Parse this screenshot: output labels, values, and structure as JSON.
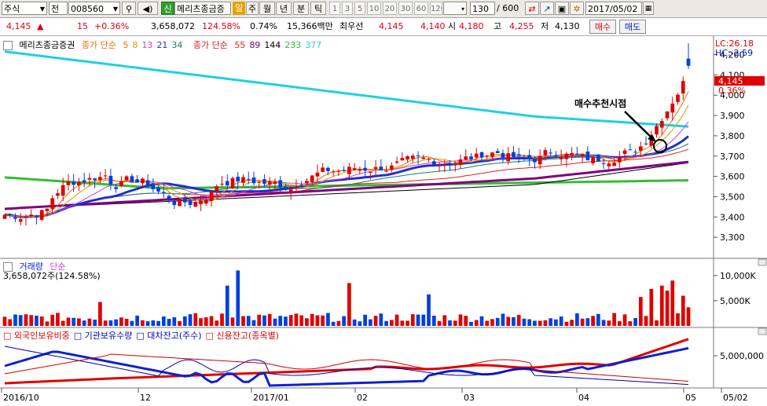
{
  "toolbar": {
    "market": "주식",
    "prev": "전",
    "code": "008560",
    "name": "메리츠종금증",
    "credit": "신",
    "periods": [
      "일",
      "주",
      "월",
      "년",
      "분",
      "틱"
    ],
    "minutes": [
      "1",
      "3",
      "5",
      "10",
      "20",
      "30",
      "60",
      "120"
    ],
    "count": "130",
    "total": "/ 600",
    "date": "2017/05/02"
  },
  "info": {
    "price": "4,145",
    "arrow": "▲",
    "change": "15",
    "rate": "+0.36%",
    "volume": "3,658,072",
    "vol_rate": "124.58%",
    "turnover": "0.74%",
    "amount": "15,366백만",
    "best_label": "최우선",
    "best_ask": "4,145",
    "best_bid": "4,140",
    "open_label": "시",
    "open": "4,180",
    "high_label": "고",
    "high": "4,255",
    "low_label": "저",
    "low": "4,130",
    "buy": "매수",
    "sell": "매도"
  },
  "price_panel": {
    "stock_label": "메리츠종금증권",
    "short_ma_label": "종가 단순",
    "short_ma": [
      {
        "p": "5",
        "c": "#f07000"
      },
      {
        "p": "8",
        "c": "#d0a000"
      },
      {
        "p": "13",
        "c": "#d040d0"
      },
      {
        "p": "21",
        "c": "#2030d0"
      },
      {
        "p": "34",
        "c": "#108070"
      }
    ],
    "long_ma_label": "종가 단순",
    "long_ma": [
      {
        "p": "55",
        "c": "#e02020"
      },
      {
        "p": "89",
        "c": "#800080"
      },
      {
        "p": "144",
        "c": "#000000"
      },
      {
        "p": "233",
        "c": "#30c030"
      },
      {
        "p": "377",
        "c": "#20d0e0"
      }
    ],
    "lc": "LC:26.18",
    "hc": "HC:-2.59",
    "current_tag": "4,145",
    "rate_tag": "0.36%",
    "annotation": "매수추천시점",
    "y_ticks": [
      "4,200",
      "4,100",
      "4,000",
      "3,900",
      "3,800",
      "3,700",
      "3,600",
      "3,500",
      "3,400",
      "3,300"
    ]
  },
  "volume_panel": {
    "title": "거래량",
    "subtitle": "단순",
    "value": "3,658,072주(124.58%)",
    "y_ticks": [
      "10,000K",
      "5,000K"
    ]
  },
  "holding_panel": {
    "items": [
      {
        "label": "외국인보유비중",
        "c": "#e00000"
      },
      {
        "label": "기관보유수량",
        "c": "#0000c0"
      },
      {
        "label": "대차잔고(주수)",
        "c": "#0000c0"
      },
      {
        "label": "신용잔고(종목별)",
        "c": "#e00000"
      }
    ],
    "y_ticks": [
      "5,000,000"
    ]
  },
  "x_axis": [
    "2016/10",
    "12",
    "2017/01",
    "02",
    "03",
    "04",
    "05",
    "05/02"
  ],
  "chart_data": {
    "type": "candlestick",
    "y_range": [
      3200,
      4260
    ],
    "last": {
      "open": 4180,
      "high": 4255,
      "low": 4130,
      "close": 4145
    },
    "ma_colors": {
      "ma5": "#f07000",
      "ma8": "#d0a000",
      "ma13": "#d040d0",
      "ma21": "#2030d0",
      "ma34": "#108070",
      "ma55": "#e02020",
      "ma89": "#800080",
      "ma144": "#000000",
      "ma233": "#30c030",
      "ma377": "#20d0e0"
    }
  }
}
